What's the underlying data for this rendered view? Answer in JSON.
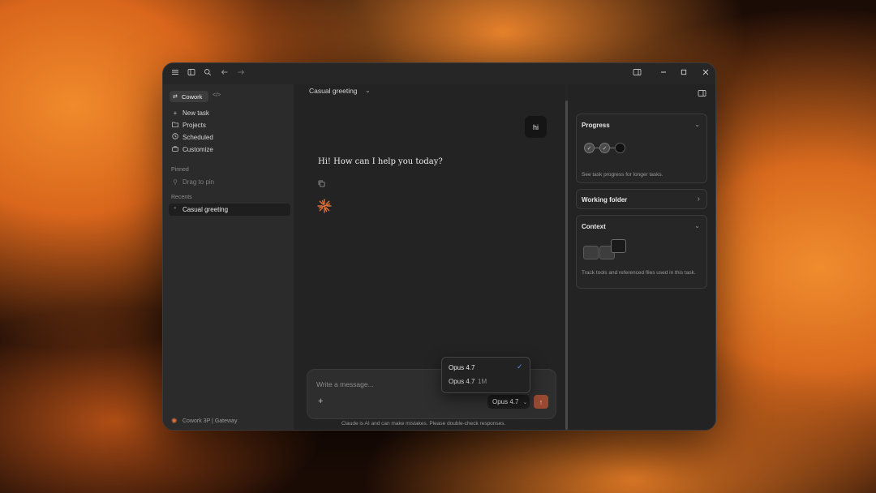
{
  "titlebar": {
    "menu_icon": "hamburger-icon",
    "sidebar_toggle_icon": "sidebar-toggle-icon",
    "search_icon": "search-icon",
    "back_icon": "arrow-left-icon",
    "forward_icon": "arrow-right-icon",
    "panel_icon": "panel-icon",
    "minimize_icon": "minimize-icon",
    "maximize_icon": "maximize-icon",
    "close_icon": "close-icon"
  },
  "sidebar": {
    "mode_label": "Cowork",
    "code_icon": "code-icon",
    "nav": [
      {
        "label": "New task",
        "icon": "plus-icon"
      },
      {
        "label": "Projects",
        "icon": "folder-icon"
      },
      {
        "label": "Scheduled",
        "icon": "clock-icon"
      },
      {
        "label": "Customize",
        "icon": "briefcase-icon"
      }
    ],
    "pinned_label": "Pinned",
    "pin_hint": "Drag to pin",
    "recents_label": "Recents",
    "recents": [
      {
        "label": "Casual greeting"
      }
    ],
    "footer_label": "Cowork 3P | Gateway"
  },
  "main": {
    "conversation_title": "Casual greeting",
    "user_message": "hi",
    "assistant_message": "Hi! How can I help you today?",
    "composer": {
      "placeholder": "Write a message...",
      "model_label": "Opus 4.7"
    },
    "model_menu": [
      {
        "name": "Opus 4.7",
        "suffix": "",
        "selected": true
      },
      {
        "name": "Opus 4.7",
        "suffix": "1M",
        "selected": false
      }
    ],
    "disclaimer": "Claude is AI and can make mistakes. Please double-check responses."
  },
  "right_panel": {
    "progress": {
      "title": "Progress",
      "description": "See task progress for longer tasks."
    },
    "working_folder": {
      "title": "Working folder"
    },
    "context": {
      "title": "Context",
      "description": "Track tools and referenced files used in this task."
    }
  },
  "colors": {
    "accent": "#e0703a",
    "send_button": "#9a4a33",
    "window_bg": "#262626"
  }
}
